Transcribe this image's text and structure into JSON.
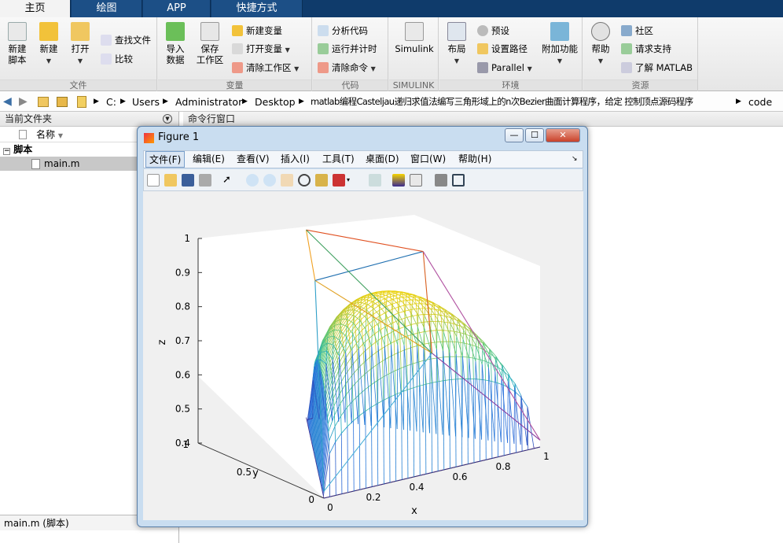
{
  "tabs": [
    "主页",
    "绘图",
    "APP",
    "快捷方式"
  ],
  "ribbon": {
    "file": {
      "label": "文件",
      "new_script": "新建\n脚本",
      "new": "新建",
      "open": "打开",
      "find_files": "查找文件",
      "compare": "比较"
    },
    "variable": {
      "label": "变量",
      "import": "导入\n数据",
      "save": "保存\n工作区",
      "new_var": "新建变量",
      "open_var": "打开变量",
      "clear_ws": "清除工作区"
    },
    "code": {
      "label": "代码",
      "analyze": "分析代码",
      "run_time": "运行并计时",
      "clear_cmd": "清除命令"
    },
    "simulink": {
      "label": "SIMULINK",
      "simulink": "Simulink"
    },
    "env": {
      "label": "环境",
      "layout": "布局",
      "prefs": "预设",
      "set_path": "设置路径",
      "parallel": "Parallel",
      "addons": "附加功能"
    },
    "resources": {
      "label": "资源",
      "help": "帮助",
      "community": "社区",
      "support": "请求支持",
      "learn": "了解 MATLAB"
    }
  },
  "address": {
    "path": [
      "C:",
      "Users",
      "Administrator",
      "Desktop",
      "matlab编程Casteljau递归求值法编写三角形域上的n次Bezier曲面计算程序，给定 控制顶点源码程序",
      "code"
    ]
  },
  "current_folder": {
    "title": "当前文件夹",
    "col_name": "名称",
    "group": "脚本",
    "file": "main.m",
    "detail": "main.m  (脚本)"
  },
  "command_window": {
    "title": "命令行窗口"
  },
  "figure": {
    "title": "Figure 1",
    "menu": [
      "文件(F)",
      "编辑(E)",
      "查看(V)",
      "插入(I)",
      "工具(T)",
      "桌面(D)",
      "窗口(W)",
      "帮助(H)"
    ],
    "axes": {
      "xlabel": "x",
      "ylabel": "y",
      "zlabel": "z",
      "xticks": [
        "0",
        "0.2",
        "0.4",
        "0.6",
        "0.8",
        "1"
      ],
      "yticks": [
        "0",
        "0.5",
        "1"
      ],
      "zticks": [
        "0.4",
        "0.5",
        "0.6",
        "0.7",
        "0.8",
        "0.9",
        "1"
      ]
    }
  },
  "colors": {
    "tabbar": "#0f3b6b",
    "accent": "#1c4f86",
    "surface_low": "#3b2a8f",
    "surface_high": "#f5d400"
  }
}
